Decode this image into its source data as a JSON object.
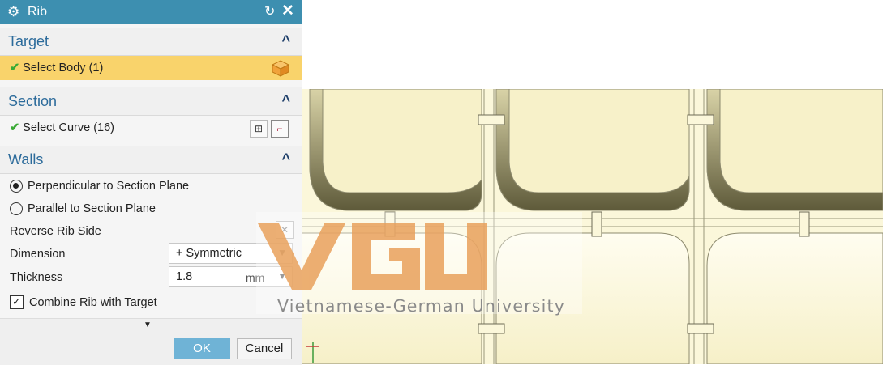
{
  "dialog": {
    "title": "Rib",
    "gear_icon": "gear-icon",
    "reset_icon": "reset-icon",
    "close_icon": "close-icon"
  },
  "target": {
    "heading": "Target",
    "select_body": "Select Body (1)"
  },
  "section": {
    "heading": "Section",
    "select_curve": "Select Curve (16)"
  },
  "walls": {
    "heading": "Walls",
    "option_perpendicular": "Perpendicular to Section Plane",
    "option_parallel": "Parallel to Section Plane",
    "selected_option": "Perpendicular to Section Plane",
    "reverse_rib_side": "Reverse Rib Side",
    "dimension_label": "Dimension",
    "dimension_value": "Symmetric",
    "dimension_symbol": "+",
    "thickness_label": "Thickness",
    "thickness_value": "1.8",
    "thickness_unit": "mm",
    "combine_label": "Combine Rib with Target",
    "combine_checked": true
  },
  "buttons": {
    "ok": "OK",
    "cancel": "Cancel"
  },
  "watermark": {
    "text": "Vietnamese-German University",
    "logo_letters": "VGU"
  },
  "colors": {
    "titlebar": "#3d8fb0",
    "selected_row": "#f9d36b",
    "section_heading": "#2c6b9b",
    "check": "#3aaa35",
    "ok_button": "#6fb3d6",
    "model_face": "#fbf7da",
    "watermark_orange": "#e9a15c"
  }
}
